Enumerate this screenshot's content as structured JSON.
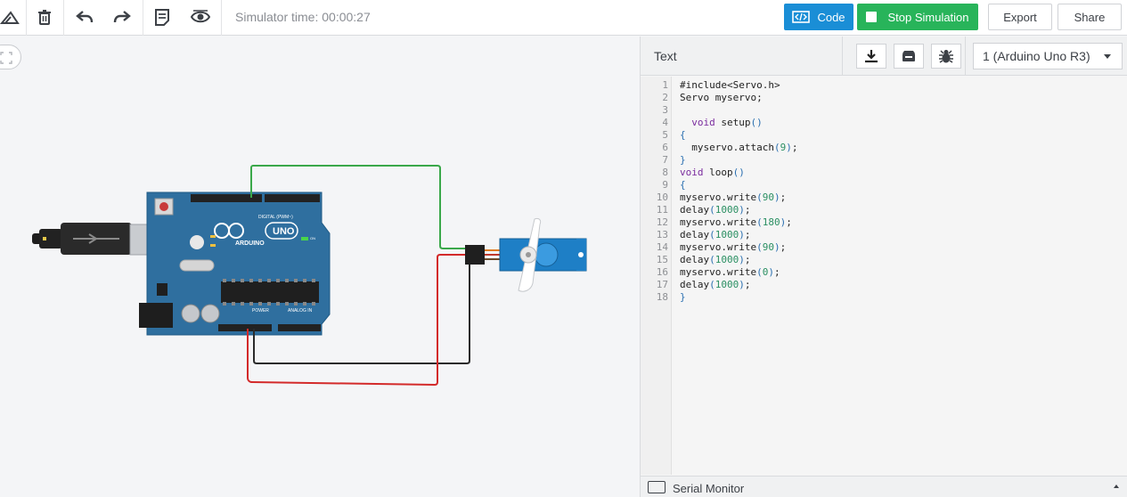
{
  "toolbar": {
    "simulator_time": "Simulator time: 00:00:27",
    "code_label": "Code",
    "stop_label": "Stop Simulation",
    "export_label": "Export",
    "share_label": "Share"
  },
  "code_panel": {
    "mode_label": "Text",
    "device_selected": "1 (Arduino Uno R3)",
    "serial_monitor_label": "Serial Monitor",
    "line_numbers": [
      "1",
      "2",
      "3",
      "4",
      "5",
      "6",
      "7",
      "8",
      "9",
      "10",
      "11",
      "12",
      "13",
      "14",
      "15",
      "16",
      "17",
      "18"
    ],
    "lines": [
      "#include<Servo.h>",
      "Servo myservo;",
      "",
      "  void setup()",
      "{",
      "  myservo.attach(9);",
      "}",
      "void loop()",
      "{",
      "myservo.write(90);",
      "delay(1000);",
      "myservo.write(180);",
      "delay(1000);",
      "myservo.write(90);",
      "delay(1000);",
      "myservo.write(0);",
      "delay(1000);",
      "}"
    ]
  },
  "board": {
    "brand": "ARDUINO",
    "model": "UNO",
    "digital_label": "DIGITAL (PWM~)",
    "power_label": "POWER",
    "analog_label": "ANALOG IN",
    "on_label": "ON"
  },
  "colors": {
    "brand_blue": "#1a8ed6",
    "stop_green": "#28b45a",
    "board_blue": "#2f6f9f",
    "wire_green": "#3aa84a",
    "wire_red": "#d32a2a",
    "wire_black": "#2b2b2b",
    "servo_blue": "#1e7fc6"
  }
}
